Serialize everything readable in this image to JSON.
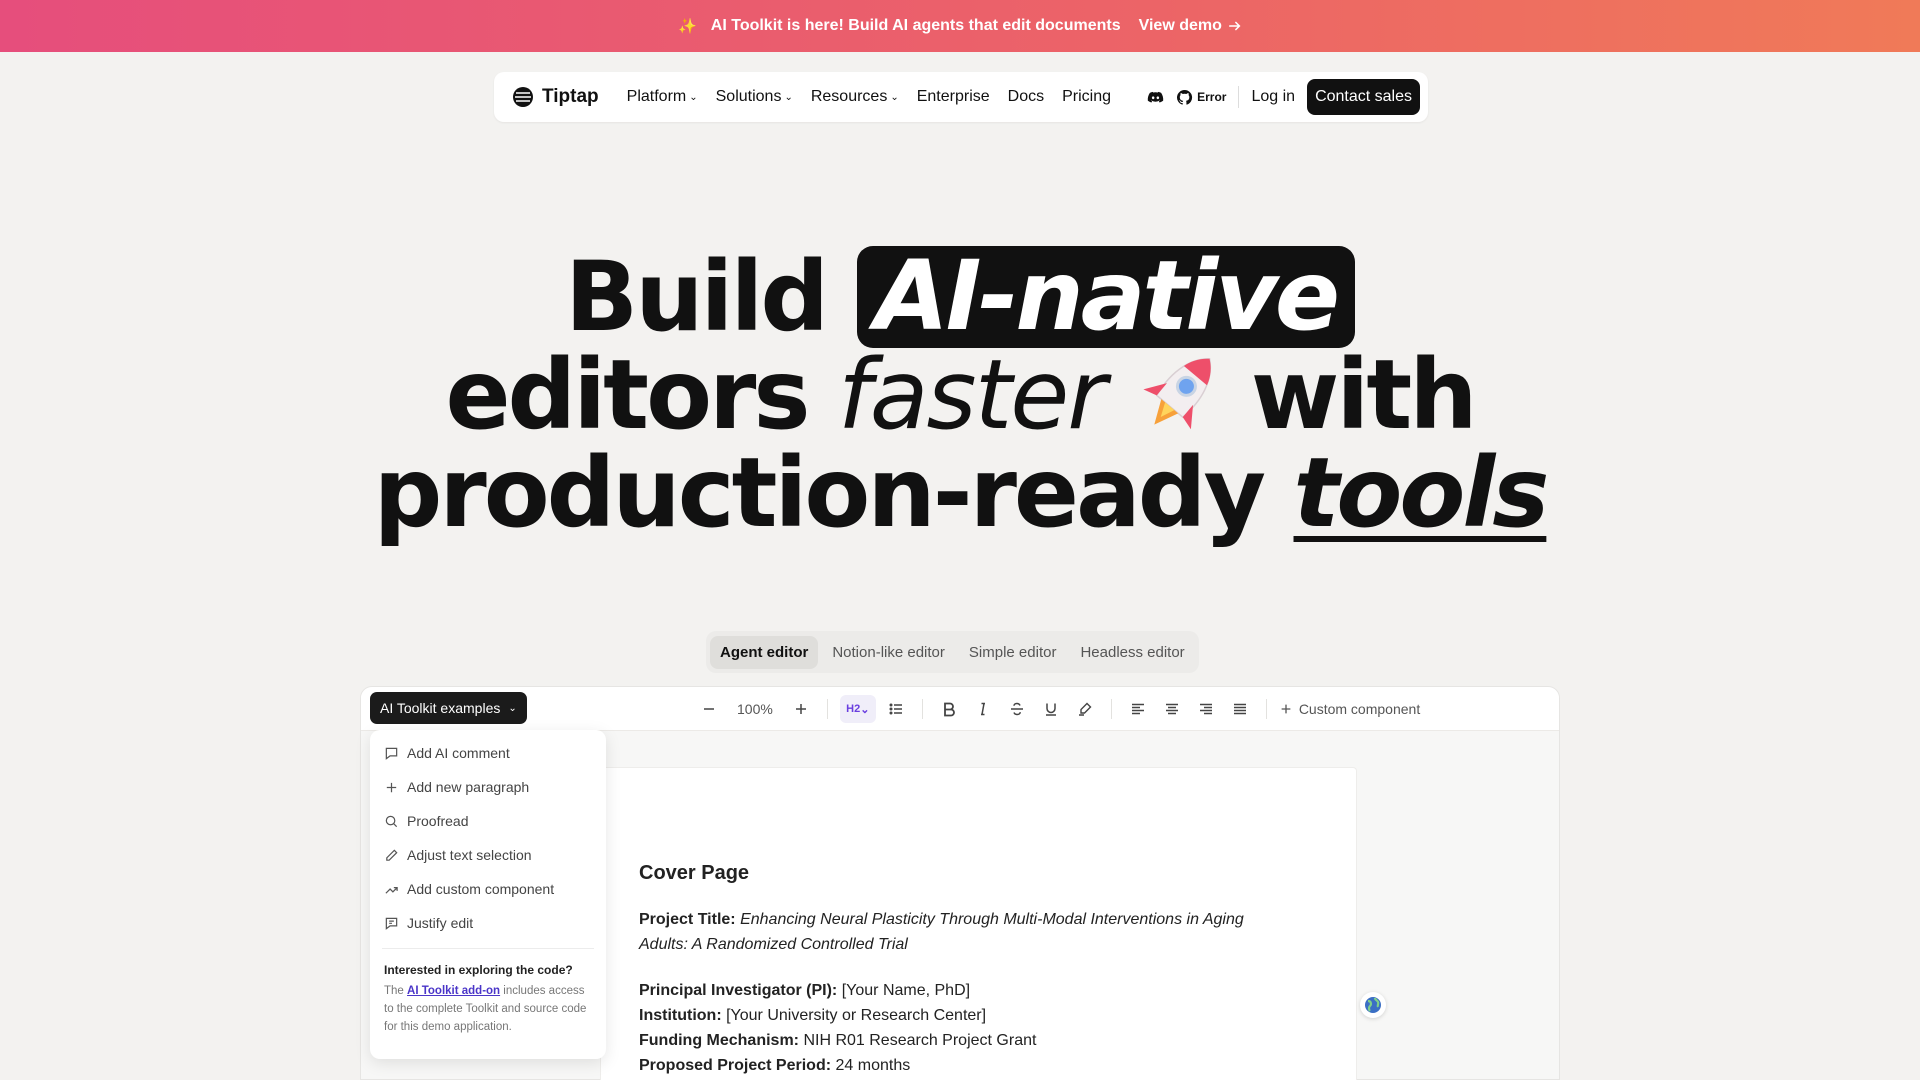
{
  "announcement": {
    "text": "AI Toolkit is here! Build AI agents that edit documents",
    "link": "View demo"
  },
  "nav": {
    "brand": "Tiptap",
    "links": [
      {
        "label": "Platform",
        "has_dropdown": true
      },
      {
        "label": "Solutions",
        "has_dropdown": true
      },
      {
        "label": "Resources",
        "has_dropdown": true
      },
      {
        "label": "Enterprise",
        "has_dropdown": false
      },
      {
        "label": "Docs",
        "has_dropdown": false
      },
      {
        "label": "Pricing",
        "has_dropdown": false
      }
    ],
    "github_label": "Error",
    "login": "Log in",
    "contact": "Contact sales"
  },
  "hero": {
    "word_build": "Build",
    "highlight": "AI-native",
    "word_editors": "editors",
    "word_faster": "faster",
    "word_with": "with",
    "word_production": "production-ready",
    "word_tools": "tools"
  },
  "tabs": [
    {
      "label": "Agent editor",
      "active": true
    },
    {
      "label": "Notion-like editor",
      "active": false
    },
    {
      "label": "Simple editor",
      "active": false
    },
    {
      "label": "Headless editor",
      "active": false
    }
  ],
  "toolbar": {
    "examples_label": "AI Toolkit examples",
    "zoom": "100%",
    "heading_label": "H2",
    "custom_component": "Custom component"
  },
  "menu": {
    "items": [
      {
        "label": "Add AI comment",
        "icon": "comment-icon"
      },
      {
        "label": "Add new paragraph",
        "icon": "plus-icon"
      },
      {
        "label": "Proofread",
        "icon": "search-icon"
      },
      {
        "label": "Adjust text selection",
        "icon": "pencil-icon"
      },
      {
        "label": "Add custom component",
        "icon": "trend-icon"
      },
      {
        "label": "Justify edit",
        "icon": "message-icon"
      }
    ],
    "note_title": "Interested in exploring the code?",
    "note_prefix": "The",
    "note_link": "AI Toolkit add-on",
    "note_suffix": "includes access to the complete Toolkit and source code for this demo application."
  },
  "document": {
    "heading": "Cover Page",
    "project_title_label": "Project Title:",
    "project_title_line1": "Enhancing Neural Plasticity Through Multi-Modal Interventions in Aging",
    "project_title_line2": "Adults: A Randomized Controlled Trial",
    "pi_label": "Principal Investigator (PI):",
    "pi_value": "[Your Name, PhD]",
    "institution_label": "Institution:",
    "institution_value": "[Your University or Research Center]",
    "funding_label": "Funding Mechanism:",
    "funding_value": "NIH R01 Research Project Grant",
    "period_label": "Proposed Project Period:",
    "period_value": "24 months"
  },
  "colors": {
    "banner_start": "#e64e7c",
    "banner_end": "#f07a58",
    "dark": "#111111",
    "accent": "#6a3fe0"
  }
}
